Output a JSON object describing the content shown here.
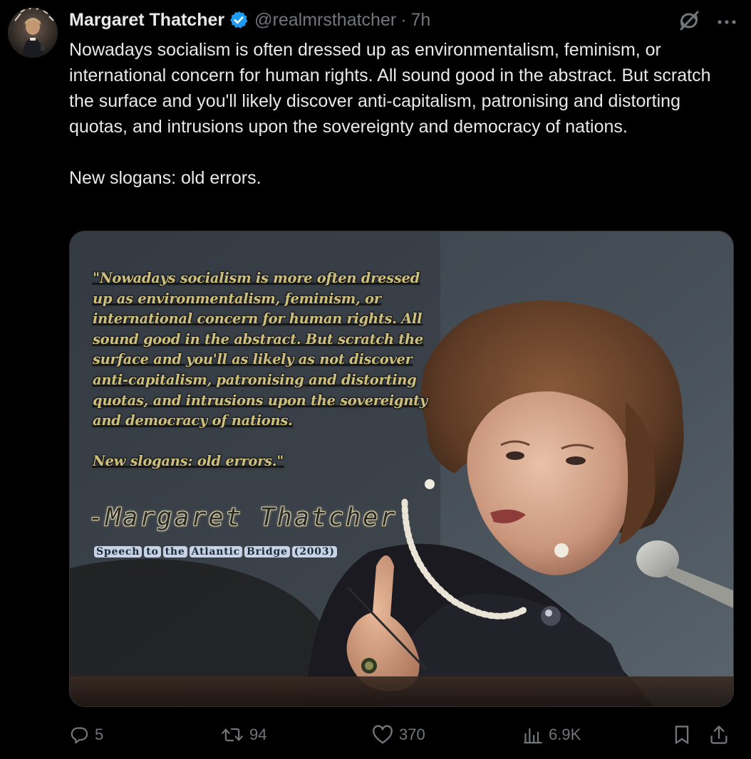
{
  "tweet": {
    "display_name": "Margaret Thatcher",
    "handle": "@realmrsthatcher",
    "separator": "·",
    "time": "7h",
    "verified_badge_color": "#1d9bf0",
    "text_paragraph_1": "Nowadays socialism is often dressed up as environmentalism, feminism, or international concern for human rights. All sound good in the abstract. But scratch the surface and you'll likely discover anti-capitalism, patronising and distorting quotas, and intrusions upon the sovereignty and democracy of nations.",
    "text_paragraph_2": "New slogans: old errors."
  },
  "media": {
    "quote_body": "\"Nowadays socialism is more often dressed up as environmentalism, feminism, or international concern for human rights. All sound good in the abstract. But scratch the surface and you'll as likely as not discover anti-capitalism, patronising and distorting quotas, and intrusions upon the sovereignty and democracy of nations.",
    "quote_slogan": "New slogans: old errors.\"",
    "quote_author": "-Margaret Thatcher",
    "quote_source_words": [
      "Speech",
      "to",
      "the",
      "Atlantic",
      "Bridge",
      "(2003)"
    ]
  },
  "actions": {
    "reply_count": "5",
    "retweet_count": "94",
    "like_count": "370",
    "views_count": "6.9K"
  },
  "icons": {
    "reply": "reply-icon",
    "retweet": "retweet-icon",
    "like": "heart-icon",
    "views": "views-icon",
    "bookmark": "bookmark-icon",
    "share": "share-icon",
    "grok": "grok-icon",
    "more": "more-icon",
    "verified": "verified-badge-icon"
  }
}
